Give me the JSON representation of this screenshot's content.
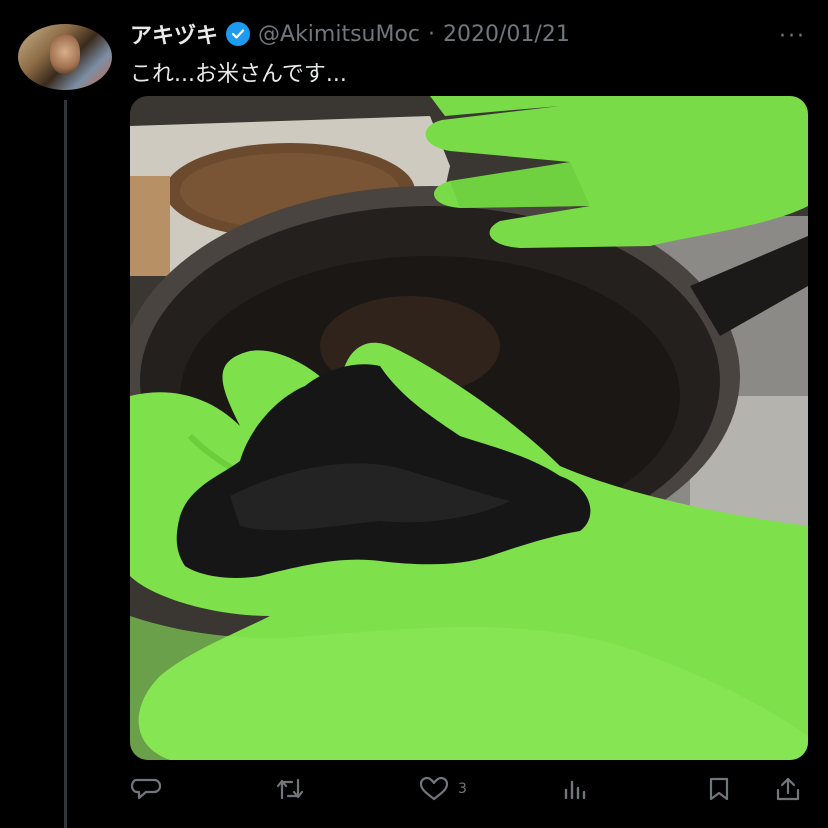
{
  "tweet": {
    "display_name": "アキヅキ",
    "handle": "@AkimitsuMoc",
    "separator": "·",
    "date": "2020/01/21",
    "text": "これ...お米さんです...",
    "more_label": "···"
  },
  "actions": {
    "like_count": "3"
  },
  "colors": {
    "background": "#000000",
    "text": "#e7e9ea",
    "muted": "#71767b",
    "verified": "#1d9bf0",
    "glove": "#7ee04a"
  },
  "icons": [
    "verified-badge-icon",
    "more-icon",
    "reply-icon",
    "retweet-icon",
    "like-icon",
    "views-icon",
    "bookmark-icon",
    "share-icon"
  ]
}
